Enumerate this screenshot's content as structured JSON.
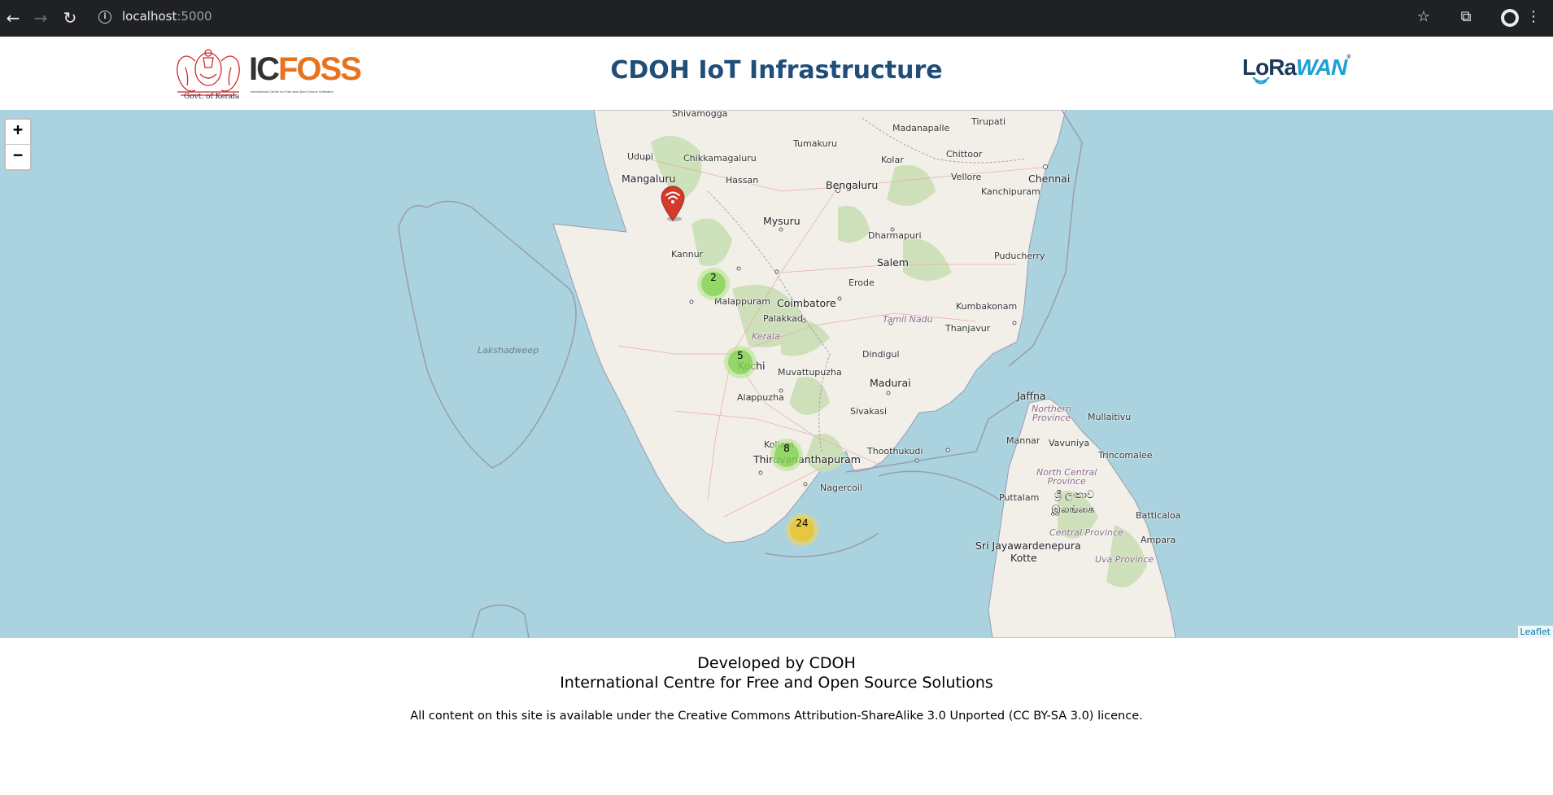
{
  "browser": {
    "url_host": "localhost",
    "url_port": ":5000",
    "back_glyph": "←",
    "forward_glyph": "→",
    "reload_glyph": "↻",
    "info_glyph": "i",
    "star_glyph": "☆",
    "extensions_glyph": "⧉",
    "menu_glyph": "⋮"
  },
  "header": {
    "title": "CDOH IoT Infrastructure",
    "kerala_caption": "Govt. of Kerala",
    "icfoss_ic": "IC",
    "icfoss_foss": "FOSS",
    "icfoss_sub": "International Centre for Free and Open Source Softwares",
    "lorawan_lo": "LoRa",
    "lorawan_wan": "WAN",
    "lorawan_reg": "®"
  },
  "map": {
    "zoom_in": "+",
    "zoom_out": "−",
    "attribution": "Leaflet",
    "places": {
      "shivamogga": "Shivamogga",
      "tirupati": "Tirupati",
      "madanapalle": "Madanapalle",
      "udupi": "Udupi",
      "chikkamagaluru": "Chikkamagaluru",
      "tumakuru": "Tumakuru",
      "kolar": "Kolar",
      "chittoor": "Chittoor",
      "mangaluru": "Mangaluru",
      "hassan": "Hassan",
      "bengaluru": "Bengaluru",
      "vellore": "Vellore",
      "chennai": "Chennai",
      "kanchipuram": "Kanchipuram",
      "mysuru": "Mysuru",
      "dharmapuri": "Dharmapuri",
      "kannur": "Kannur",
      "salem": "Salem",
      "puducherry": "Puducherry",
      "erode": "Erode",
      "malappuram": "Malappuram",
      "coimbatore": "Coimbatore",
      "kumbakonam": "Kumbakonam",
      "palakkad": "Palakkad",
      "tamil_nadu": "Tamil Nadu",
      "thanjavur": "Thanjavur",
      "kerala": "Kerala",
      "lakshadweep": "Lakshadweep",
      "dindigul": "Dindigul",
      "kochi": "Kochi",
      "muvattupuzha": "Muvattupuzha",
      "madurai": "Madurai",
      "alappuzha": "Alappuzha",
      "jaffna": "Jaffna",
      "sivakasi": "Sivakasi",
      "northern_province": "Northern\nProvince",
      "mullaitivu": "Mullaitivu",
      "kollam": "Kollam",
      "mannar": "Mannar",
      "vavuniya": "Vavuniya",
      "thoothukudi": "Thoothukudi",
      "thiruvananthapuram": "Thiruvananthapuram",
      "trincomalee": "Trincomalee",
      "north_central": "North Central\nProvince",
      "nagercoil": "Nagercoil",
      "sri_lanka_si": "ශ්‍රී ලංකාව",
      "sri_lanka_ta": "இலங்கை",
      "puttalam": "Puttalam",
      "batticaloa": "Batticaloa",
      "central_province": "Central Province",
      "ampara": "Ampara",
      "sri_jayawardenepura": "Sri Jayawardenepura",
      "kotte": "Kotte",
      "uva_province": "Uva Province"
    },
    "clusters": [
      {
        "count": "2",
        "size": "small"
      },
      {
        "count": "5",
        "size": "small"
      },
      {
        "count": "8",
        "size": "small"
      },
      {
        "count": "24",
        "size": "medium"
      }
    ],
    "marker_icon": "wifi-icon"
  },
  "footer": {
    "line1": "Developed by CDOH",
    "line2": "International Centre for Free and Open Source Solutions",
    "license": "All content on this site is available under the Creative Commons Attribution-ShareAlike 3.0 Unported (CC BY-SA 3.0) licence."
  }
}
